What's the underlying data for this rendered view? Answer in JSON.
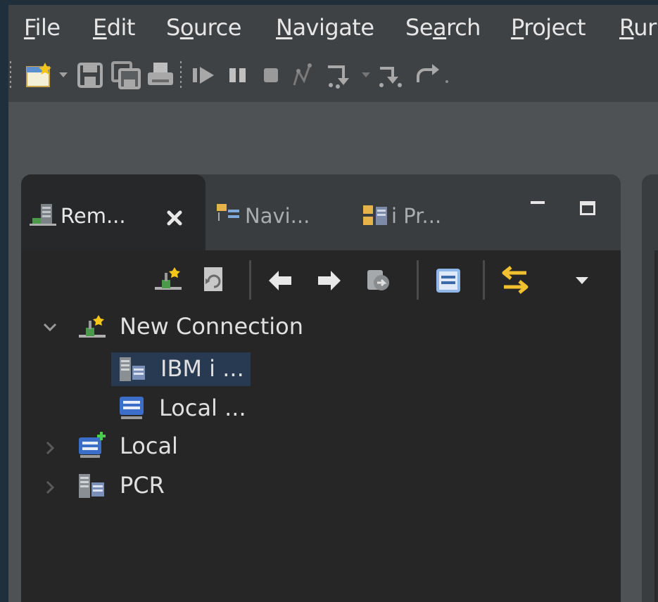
{
  "menubar": {
    "items": [
      {
        "pre": "",
        "mn": "F",
        "post": "ile"
      },
      {
        "pre": "",
        "mn": "E",
        "post": "dit"
      },
      {
        "pre": "S",
        "mn": "o",
        "post": "urce"
      },
      {
        "pre": "",
        "mn": "N",
        "post": "avigate"
      },
      {
        "pre": "Se",
        "mn": "a",
        "post": "rch"
      },
      {
        "pre": "",
        "mn": "P",
        "post": "roject"
      },
      {
        "pre": "",
        "mn": "R",
        "post": "ur"
      }
    ]
  },
  "toolbar": {
    "icons": [
      "new-icon",
      "dropdown-arrow-icon",
      "save-icon",
      "save-all-icon",
      "print-icon",
      "resume-icon",
      "suspend-icon",
      "terminate-icon",
      "disconnect-icon",
      "step-into-icon",
      "dropdown-arrow-icon",
      "step-over-icon",
      "step-return-icon"
    ]
  },
  "view": {
    "tabs": [
      {
        "label": "Rem...",
        "icon": "remote-systems-icon",
        "active": true
      },
      {
        "label": "Navi...",
        "icon": "navigator-icon",
        "active": false
      },
      {
        "label": "i Pr...",
        "icon": "i-projects-icon",
        "active": false
      }
    ],
    "view_toolbar_icons": [
      "new-connection-icon",
      "refresh-icon",
      "back-icon",
      "forward-icon",
      "go-into-icon",
      "collapse-all-icon",
      "link-with-editor-icon",
      "view-menu-icon"
    ],
    "tree": [
      {
        "label": "New Connection",
        "icon": "new-connection-icon",
        "expanded": true,
        "level": 0
      },
      {
        "label": "IBM i ...",
        "icon": "ibm-i-server-icon",
        "level": 1,
        "selected": true
      },
      {
        "label": "Local ...",
        "icon": "local-monitor-icon",
        "level": 1
      },
      {
        "label": "Local",
        "icon": "local-connection-icon",
        "expanded": false,
        "level": 0
      },
      {
        "label": "PCR",
        "icon": "ibm-i-server-icon",
        "expanded": false,
        "level": 0
      }
    ]
  },
  "colors": {
    "background": "#1f2f3c",
    "chrome": "#3e4245",
    "view_body": "#262626",
    "selection": "#283a52",
    "text": "#e0e0e0"
  }
}
